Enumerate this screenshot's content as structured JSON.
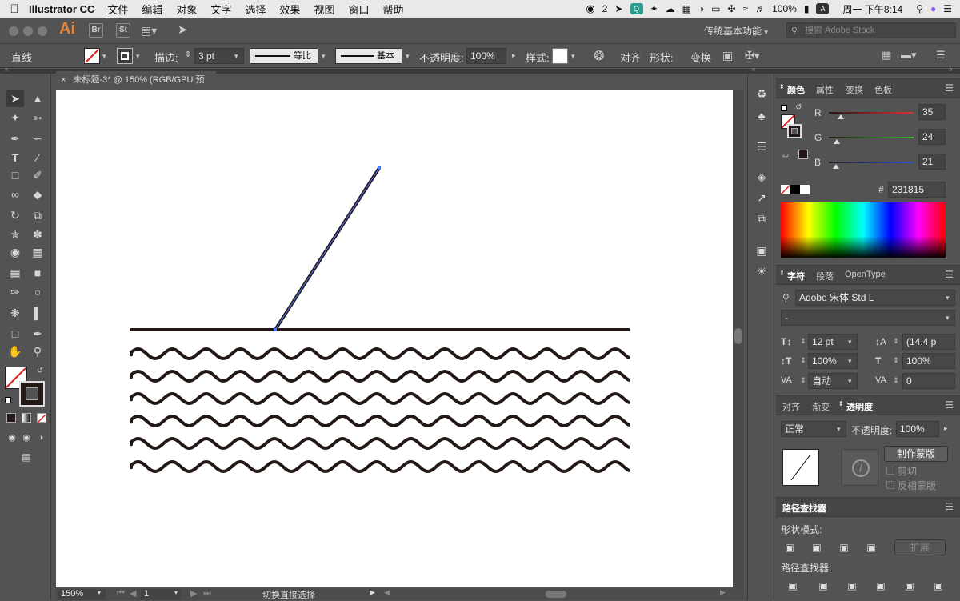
{
  "menubar": {
    "apple": "",
    "app_name": "Illustrator CC",
    "menus": [
      "文件",
      "编辑",
      "对象",
      "文字",
      "选择",
      "效果",
      "视图",
      "窗口",
      "帮助"
    ],
    "status": {
      "wechat_count": "2",
      "battery": "100%",
      "date_time": "周一 下午8:14",
      "input": "A"
    }
  },
  "appbar": {
    "logo": "Ai",
    "bridge": "Br",
    "stock_btn": "St",
    "workspace": "传统基本功能",
    "search_placeholder": "搜索 Adobe Stock"
  },
  "control": {
    "object_type": "直线",
    "stroke_label": "描边:",
    "stroke_value": "3 pt",
    "profile": "等比",
    "brush": "基本",
    "opacity_label": "不透明度:",
    "opacity_value": "100%",
    "style_label": "样式:",
    "align": "对齐",
    "shape": "形状:",
    "transform": "变换"
  },
  "document": {
    "tab_title": "未标题-3* @ 150% (RGB/GPU 预览)",
    "zoom": "150%",
    "artboard_num": "1",
    "status_text": "切换直接选择"
  },
  "color_panel": {
    "tabs": [
      "颜色",
      "属性",
      "变换",
      "色板"
    ],
    "r_label": "R",
    "g_label": "G",
    "b_label": "B",
    "r": 35,
    "g": 24,
    "b": 21,
    "hex_label": "#",
    "hex": "231815",
    "r_color": "#e03030",
    "g_color": "#30c030",
    "b_color": "#3050e0"
  },
  "char_panel": {
    "tabs": [
      "字符",
      "段落",
      "OpenType"
    ],
    "font_family": "Adobe 宋体 Std L",
    "font_style": "-",
    "size": "12 pt",
    "leading": "(14.4 p",
    "vscale": "100%",
    "hscale": "100%",
    "kerning": "自动",
    "tracking": "0"
  },
  "transparency_panel": {
    "tabs": [
      "对齐",
      "渐变",
      "透明度"
    ],
    "blend": "正常",
    "opacity_label": "不透明度:",
    "opacity": "100%",
    "make_mask": "制作蒙版",
    "clip": "剪切",
    "invert": "反相蒙版"
  },
  "pathfinder_panel": {
    "title": "路径查找器",
    "shape_modes": "形状模式:",
    "expand": "扩展",
    "pathfinders": "路径查找器:"
  },
  "colors": {
    "stroke": "#231815",
    "selection": "#4a78ff",
    "canvas": "#ffffff",
    "ui": "#535353"
  }
}
